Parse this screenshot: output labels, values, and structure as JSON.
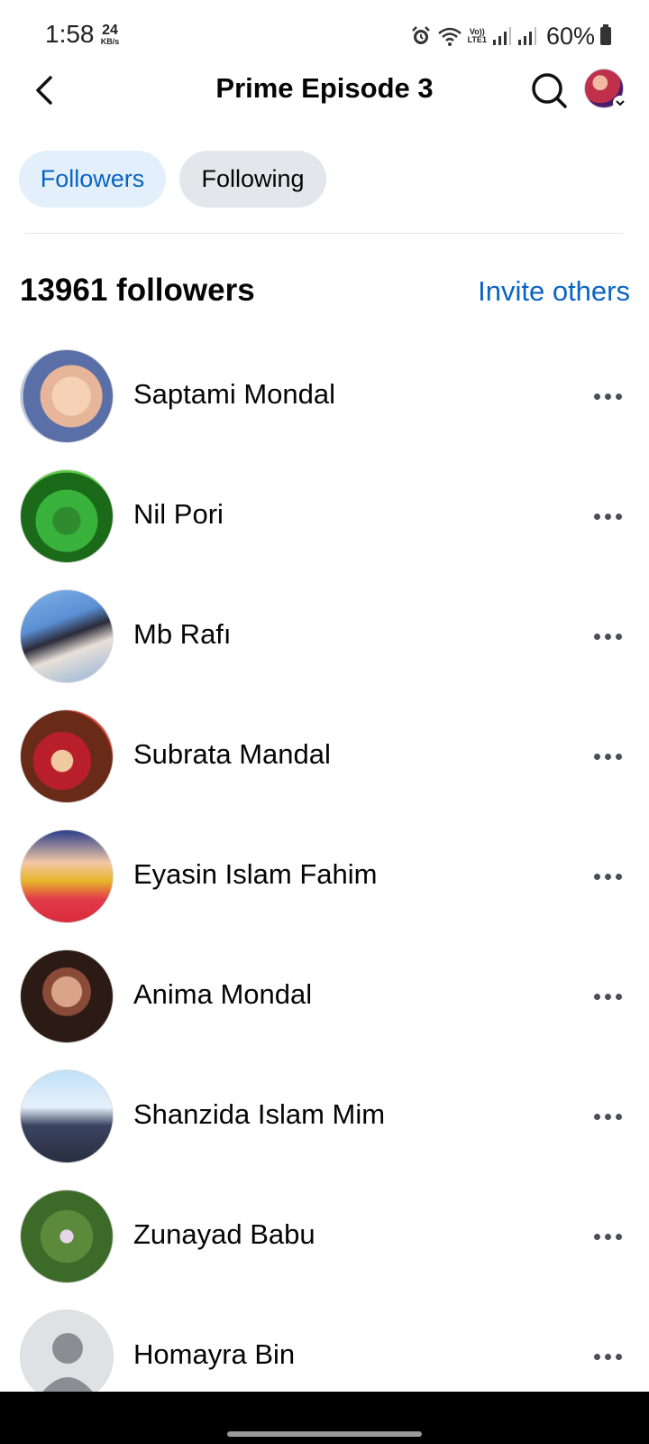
{
  "status_bar": {
    "time": "1:58",
    "net_speed": "24",
    "net_unit": "KB/s",
    "lte_label_top": "Vo))",
    "lte_label_bottom": "LTE1",
    "battery": "60%"
  },
  "header": {
    "title": "Prime Episode 3",
    "back_icon": "back-arrow-icon",
    "search_icon": "search-icon"
  },
  "tabs": [
    {
      "label": "Followers",
      "active": true
    },
    {
      "label": "Following",
      "active": false
    }
  ],
  "followers_section": {
    "count_label": "13961 followers",
    "invite_label": "Invite others"
  },
  "followers": [
    {
      "name": "Saptami Mondal"
    },
    {
      "name": "Nil Pori"
    },
    {
      "name": "Mb Rafı"
    },
    {
      "name": "Subrata Mandal"
    },
    {
      "name": "Eyasin Islam Fahim"
    },
    {
      "name": "Anima Mondal"
    },
    {
      "name": "Shanzida Islam Mim"
    },
    {
      "name": "Zunayad Babu"
    },
    {
      "name": "Homayra Bin"
    }
  ],
  "colors": {
    "accent": "#0a64c2",
    "active_tab_bg": "#e3f0fc",
    "inactive_tab_bg": "#e4e6eb"
  }
}
